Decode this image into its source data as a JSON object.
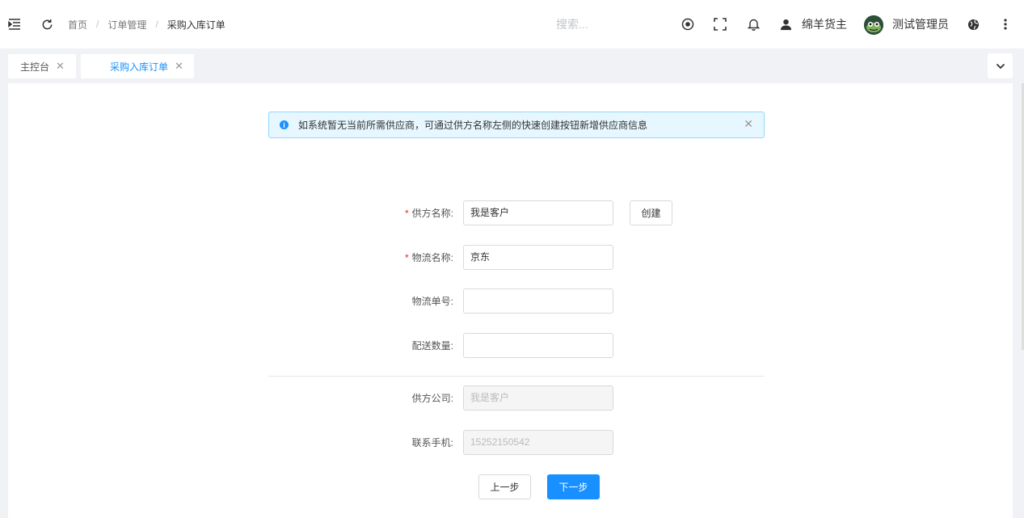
{
  "breadcrumb": [
    "首页",
    "订单管理",
    "采购入库订单"
  ],
  "search": {
    "placeholder": "搜索..."
  },
  "header": {
    "user_name": "绵羊货主",
    "admin_name": "测试管理员"
  },
  "tabs": [
    {
      "label": "主控台",
      "active": false
    },
    {
      "label": "采购入库订单",
      "active": true
    }
  ],
  "alert": {
    "text": "如系统暂无当前所需供应商，可通过供方名称左侧的快速创建按钮新增供应商信息"
  },
  "form": {
    "supplier_name": {
      "label": "供方名称",
      "value": "我是客户",
      "required": true
    },
    "create_label": "创建",
    "logistics_name": {
      "label": "物流名称",
      "value": "京东",
      "required": true
    },
    "logistics_no": {
      "label": "物流单号",
      "value": ""
    },
    "delivery_qty": {
      "label": "配送数量",
      "value": ""
    },
    "supplier_company": {
      "label": "供方公司",
      "value": "我是客户"
    },
    "contact_phone": {
      "label": "联系手机",
      "value": "15252150542"
    }
  },
  "buttons": {
    "prev": "上一步",
    "next": "下一步"
  },
  "colors": {
    "primary": "#1890ff",
    "required": "#f5222d",
    "alert_bg": "#e6f7ff"
  }
}
